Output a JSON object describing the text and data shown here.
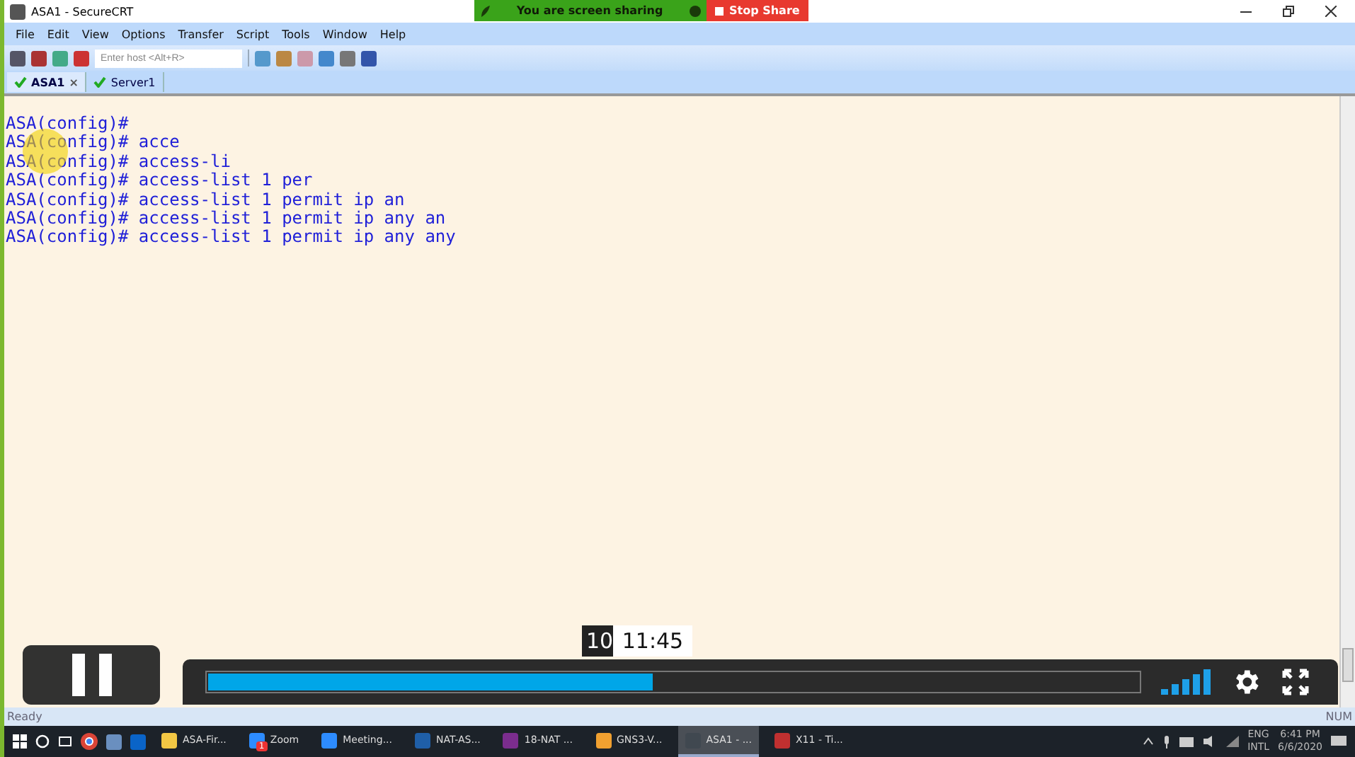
{
  "share_banner": {
    "message": "You are screen sharing",
    "stop_label": "Stop Share"
  },
  "window": {
    "title": "ASA1 - SecureCRT"
  },
  "menu": [
    "File",
    "Edit",
    "View",
    "Options",
    "Transfer",
    "Script",
    "Tools",
    "Window",
    "Help"
  ],
  "toolbar": {
    "host_placeholder": "Enter host <Alt+R>"
  },
  "tabs": [
    {
      "label": "ASA1",
      "selected": true,
      "close": "×"
    },
    {
      "label": "Server1",
      "selected": false
    }
  ],
  "terminal": {
    "lines": [
      "ASA(config)#",
      "ASA(config)# acce",
      "ASA(config)# access-li",
      "ASA(config)# access-list 1 per",
      "ASA(config)# access-list 1 permit ip an",
      "ASA(config)# access-list 1 permit ip any an",
      "ASA(config)# access-list 1 permit ip any any"
    ]
  },
  "status_bar": {
    "left": "Ready",
    "right": "NUM"
  },
  "player": {
    "playing": true,
    "level": 0.478,
    "current_time": "10",
    "hover_time": "11:45"
  },
  "taskbar": {
    "items": [
      {
        "label": "ASA-Fir...",
        "color": "#f2c744",
        "selected": false
      },
      {
        "label": "Zoom",
        "color": "#2d8cff",
        "selected": false,
        "badge": "1"
      },
      {
        "label": "Meeting...",
        "color": "#2d8cff",
        "selected": false
      },
      {
        "label": "NAT-AS...",
        "color": "#1f5fa8",
        "selected": false
      },
      {
        "label": "18-NAT ...",
        "color": "#7b2d8e",
        "selected": false
      },
      {
        "label": "GNS3-V...",
        "color": "#f0a030",
        "selected": false
      },
      {
        "label": "ASA1 - ...",
        "color": "#404850",
        "selected": true
      },
      {
        "label": "X11 - Ti...",
        "color": "#c03030",
        "selected": false
      }
    ],
    "language": "ENG",
    "layout": "INTL",
    "time": "6:41 PM",
    "date": "6/6/2020"
  }
}
